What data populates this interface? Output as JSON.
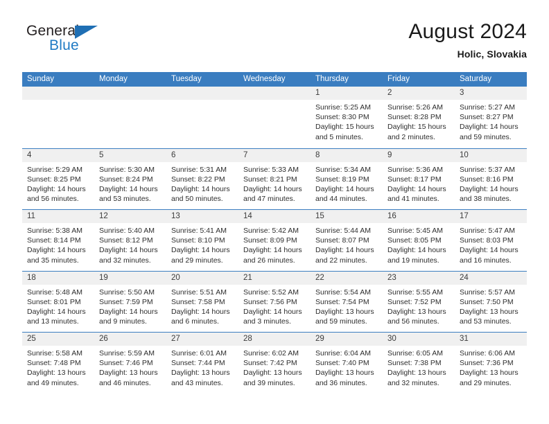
{
  "brand": {
    "name_part1": "General",
    "name_part2": "Blue",
    "logo_icon": "triangle-logo-icon",
    "accent_color": "#1f7ac4"
  },
  "header": {
    "month_title": "August 2024",
    "location": "Holic, Slovakia"
  },
  "theme": {
    "header_blue": "#3a7dc0",
    "date_band_gray": "#f0f0f0",
    "text_color": "#2d2d2d"
  },
  "calendar": {
    "weekday_headers": [
      "Sunday",
      "Monday",
      "Tuesday",
      "Wednesday",
      "Thursday",
      "Friday",
      "Saturday"
    ],
    "weeks": [
      [
        {
          "day": "",
          "empty": true,
          "sunrise": "",
          "sunset": "",
          "daylight": ""
        },
        {
          "day": "",
          "empty": true,
          "sunrise": "",
          "sunset": "",
          "daylight": ""
        },
        {
          "day": "",
          "empty": true,
          "sunrise": "",
          "sunset": "",
          "daylight": ""
        },
        {
          "day": "",
          "empty": true,
          "sunrise": "",
          "sunset": "",
          "daylight": ""
        },
        {
          "day": "1",
          "empty": false,
          "sunrise": "Sunrise: 5:25 AM",
          "sunset": "Sunset: 8:30 PM",
          "daylight": "Daylight: 15 hours and 5 minutes."
        },
        {
          "day": "2",
          "empty": false,
          "sunrise": "Sunrise: 5:26 AM",
          "sunset": "Sunset: 8:28 PM",
          "daylight": "Daylight: 15 hours and 2 minutes."
        },
        {
          "day": "3",
          "empty": false,
          "sunrise": "Sunrise: 5:27 AM",
          "sunset": "Sunset: 8:27 PM",
          "daylight": "Daylight: 14 hours and 59 minutes."
        }
      ],
      [
        {
          "day": "4",
          "empty": false,
          "sunrise": "Sunrise: 5:29 AM",
          "sunset": "Sunset: 8:25 PM",
          "daylight": "Daylight: 14 hours and 56 minutes."
        },
        {
          "day": "5",
          "empty": false,
          "sunrise": "Sunrise: 5:30 AM",
          "sunset": "Sunset: 8:24 PM",
          "daylight": "Daylight: 14 hours and 53 minutes."
        },
        {
          "day": "6",
          "empty": false,
          "sunrise": "Sunrise: 5:31 AM",
          "sunset": "Sunset: 8:22 PM",
          "daylight": "Daylight: 14 hours and 50 minutes."
        },
        {
          "day": "7",
          "empty": false,
          "sunrise": "Sunrise: 5:33 AM",
          "sunset": "Sunset: 8:21 PM",
          "daylight": "Daylight: 14 hours and 47 minutes."
        },
        {
          "day": "8",
          "empty": false,
          "sunrise": "Sunrise: 5:34 AM",
          "sunset": "Sunset: 8:19 PM",
          "daylight": "Daylight: 14 hours and 44 minutes."
        },
        {
          "day": "9",
          "empty": false,
          "sunrise": "Sunrise: 5:36 AM",
          "sunset": "Sunset: 8:17 PM",
          "daylight": "Daylight: 14 hours and 41 minutes."
        },
        {
          "day": "10",
          "empty": false,
          "sunrise": "Sunrise: 5:37 AM",
          "sunset": "Sunset: 8:16 PM",
          "daylight": "Daylight: 14 hours and 38 minutes."
        }
      ],
      [
        {
          "day": "11",
          "empty": false,
          "sunrise": "Sunrise: 5:38 AM",
          "sunset": "Sunset: 8:14 PM",
          "daylight": "Daylight: 14 hours and 35 minutes."
        },
        {
          "day": "12",
          "empty": false,
          "sunrise": "Sunrise: 5:40 AM",
          "sunset": "Sunset: 8:12 PM",
          "daylight": "Daylight: 14 hours and 32 minutes."
        },
        {
          "day": "13",
          "empty": false,
          "sunrise": "Sunrise: 5:41 AM",
          "sunset": "Sunset: 8:10 PM",
          "daylight": "Daylight: 14 hours and 29 minutes."
        },
        {
          "day": "14",
          "empty": false,
          "sunrise": "Sunrise: 5:42 AM",
          "sunset": "Sunset: 8:09 PM",
          "daylight": "Daylight: 14 hours and 26 minutes."
        },
        {
          "day": "15",
          "empty": false,
          "sunrise": "Sunrise: 5:44 AM",
          "sunset": "Sunset: 8:07 PM",
          "daylight": "Daylight: 14 hours and 22 minutes."
        },
        {
          "day": "16",
          "empty": false,
          "sunrise": "Sunrise: 5:45 AM",
          "sunset": "Sunset: 8:05 PM",
          "daylight": "Daylight: 14 hours and 19 minutes."
        },
        {
          "day": "17",
          "empty": false,
          "sunrise": "Sunrise: 5:47 AM",
          "sunset": "Sunset: 8:03 PM",
          "daylight": "Daylight: 14 hours and 16 minutes."
        }
      ],
      [
        {
          "day": "18",
          "empty": false,
          "sunrise": "Sunrise: 5:48 AM",
          "sunset": "Sunset: 8:01 PM",
          "daylight": "Daylight: 14 hours and 13 minutes."
        },
        {
          "day": "19",
          "empty": false,
          "sunrise": "Sunrise: 5:50 AM",
          "sunset": "Sunset: 7:59 PM",
          "daylight": "Daylight: 14 hours and 9 minutes."
        },
        {
          "day": "20",
          "empty": false,
          "sunrise": "Sunrise: 5:51 AM",
          "sunset": "Sunset: 7:58 PM",
          "daylight": "Daylight: 14 hours and 6 minutes."
        },
        {
          "day": "21",
          "empty": false,
          "sunrise": "Sunrise: 5:52 AM",
          "sunset": "Sunset: 7:56 PM",
          "daylight": "Daylight: 14 hours and 3 minutes."
        },
        {
          "day": "22",
          "empty": false,
          "sunrise": "Sunrise: 5:54 AM",
          "sunset": "Sunset: 7:54 PM",
          "daylight": "Daylight: 13 hours and 59 minutes."
        },
        {
          "day": "23",
          "empty": false,
          "sunrise": "Sunrise: 5:55 AM",
          "sunset": "Sunset: 7:52 PM",
          "daylight": "Daylight: 13 hours and 56 minutes."
        },
        {
          "day": "24",
          "empty": false,
          "sunrise": "Sunrise: 5:57 AM",
          "sunset": "Sunset: 7:50 PM",
          "daylight": "Daylight: 13 hours and 53 minutes."
        }
      ],
      [
        {
          "day": "25",
          "empty": false,
          "sunrise": "Sunrise: 5:58 AM",
          "sunset": "Sunset: 7:48 PM",
          "daylight": "Daylight: 13 hours and 49 minutes."
        },
        {
          "day": "26",
          "empty": false,
          "sunrise": "Sunrise: 5:59 AM",
          "sunset": "Sunset: 7:46 PM",
          "daylight": "Daylight: 13 hours and 46 minutes."
        },
        {
          "day": "27",
          "empty": false,
          "sunrise": "Sunrise: 6:01 AM",
          "sunset": "Sunset: 7:44 PM",
          "daylight": "Daylight: 13 hours and 43 minutes."
        },
        {
          "day": "28",
          "empty": false,
          "sunrise": "Sunrise: 6:02 AM",
          "sunset": "Sunset: 7:42 PM",
          "daylight": "Daylight: 13 hours and 39 minutes."
        },
        {
          "day": "29",
          "empty": false,
          "sunrise": "Sunrise: 6:04 AM",
          "sunset": "Sunset: 7:40 PM",
          "daylight": "Daylight: 13 hours and 36 minutes."
        },
        {
          "day": "30",
          "empty": false,
          "sunrise": "Sunrise: 6:05 AM",
          "sunset": "Sunset: 7:38 PM",
          "daylight": "Daylight: 13 hours and 32 minutes."
        },
        {
          "day": "31",
          "empty": false,
          "sunrise": "Sunrise: 6:06 AM",
          "sunset": "Sunset: 7:36 PM",
          "daylight": "Daylight: 13 hours and 29 minutes."
        }
      ]
    ]
  }
}
